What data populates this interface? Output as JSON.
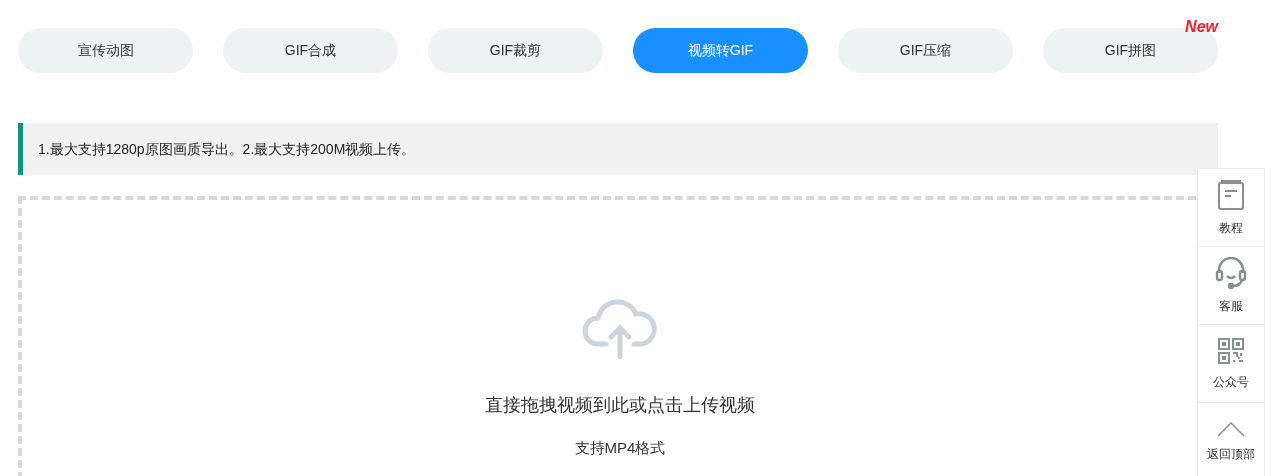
{
  "tabs": [
    {
      "label": "宣传动图",
      "selected": false
    },
    {
      "label": "GIF合成",
      "selected": false
    },
    {
      "label": "GIF裁剪",
      "selected": false
    },
    {
      "label": "视频转GIF",
      "selected": true
    },
    {
      "label": "GIF压缩",
      "selected": false
    },
    {
      "label": "GIF拼图",
      "selected": false,
      "badge": "New"
    }
  ],
  "notice": "1.最大支持1280p原图画质导出。2.最大支持200M视频上传。",
  "dropzone": {
    "title": "直接拖拽视频到此或点击上传视频",
    "hint": "支持MP4格式"
  },
  "sidebar": [
    {
      "kind": "book",
      "label": "教程"
    },
    {
      "kind": "headset",
      "label": "客服"
    },
    {
      "kind": "qr",
      "label": "公众号"
    },
    {
      "kind": "top",
      "label": "返回顶部"
    }
  ]
}
